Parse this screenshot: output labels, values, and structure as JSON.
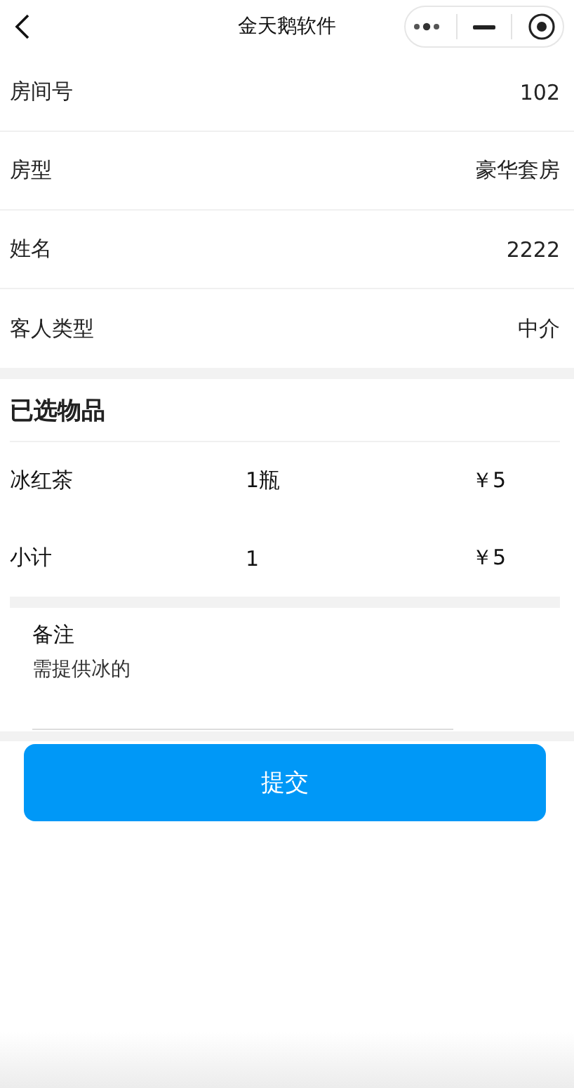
{
  "nav_bar": {
    "title": "金天鹅软件"
  },
  "fields": [
    {
      "label": "房间号",
      "value": "102"
    },
    {
      "label": "房型",
      "value": "豪华套房"
    },
    {
      "label": "姓名",
      "value": "2222"
    },
    {
      "label": "客人类型",
      "value": "中介"
    }
  ],
  "selected_items": {
    "title": "已选物品",
    "rows": [
      {
        "name": "冰红茶",
        "quantity": "1瓶",
        "price": "￥5"
      },
      {
        "name": "小计",
        "quantity": "1",
        "price": "￥5"
      }
    ]
  },
  "remark": {
    "label": "备注",
    "value": "需提供冰的"
  },
  "submit_button": "提交"
}
